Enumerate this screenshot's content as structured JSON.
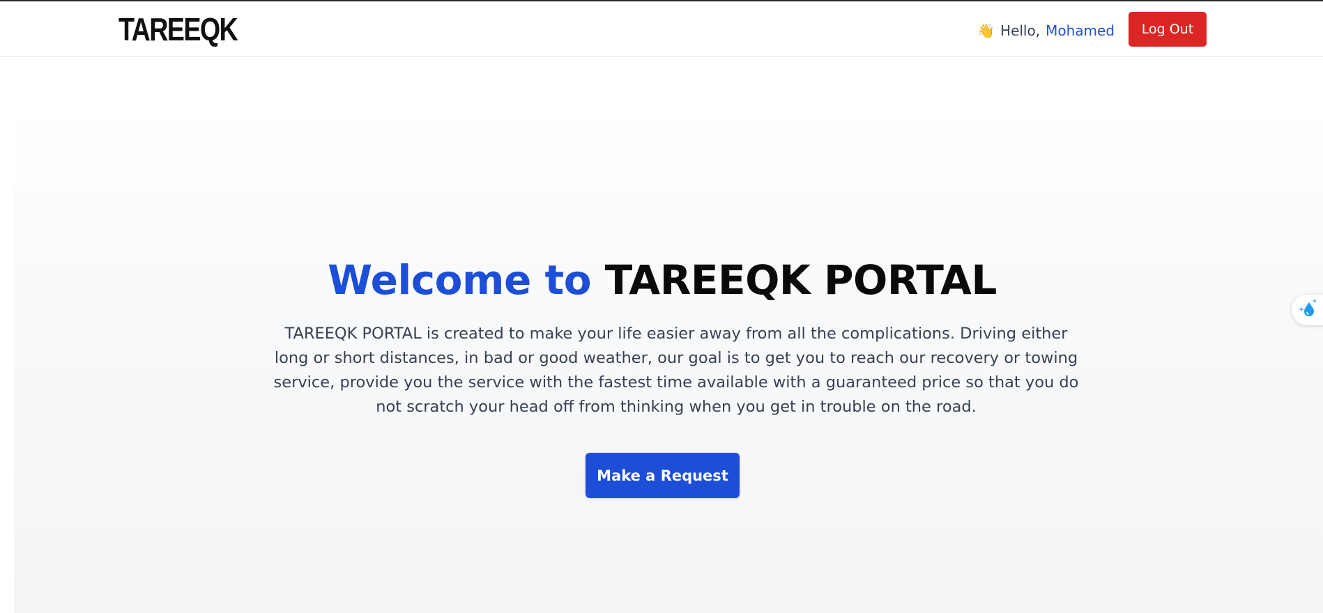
{
  "navbar": {
    "logo_text": "TAREEQK",
    "greeting_prefix": "Hello,",
    "user_name": "Mohamed",
    "logout_label": "Log Out"
  },
  "hero": {
    "title_welcome": "Welcome to",
    "title_portal": "TAREEQK PORTAL",
    "description": "TAREEQK PORTAL is created to make your life easier away from all the complications. Driving either long or short distances, in bad or good weather, our goal is to get you to reach our recovery or towing service, provide you the service with the fastest time available with a guaranteed price so that you do not scratch your head off from thinking when you get in trouble on the road.",
    "request_button_label": "Make a Request"
  },
  "icons": {
    "greeting": "waving-hand-icon",
    "side_widget": "water-drop-sparkle-icon"
  },
  "colors": {
    "accent_blue": "#1d4ed8",
    "logout_red": "#dc2626",
    "logo_accent": "#f4b400"
  }
}
